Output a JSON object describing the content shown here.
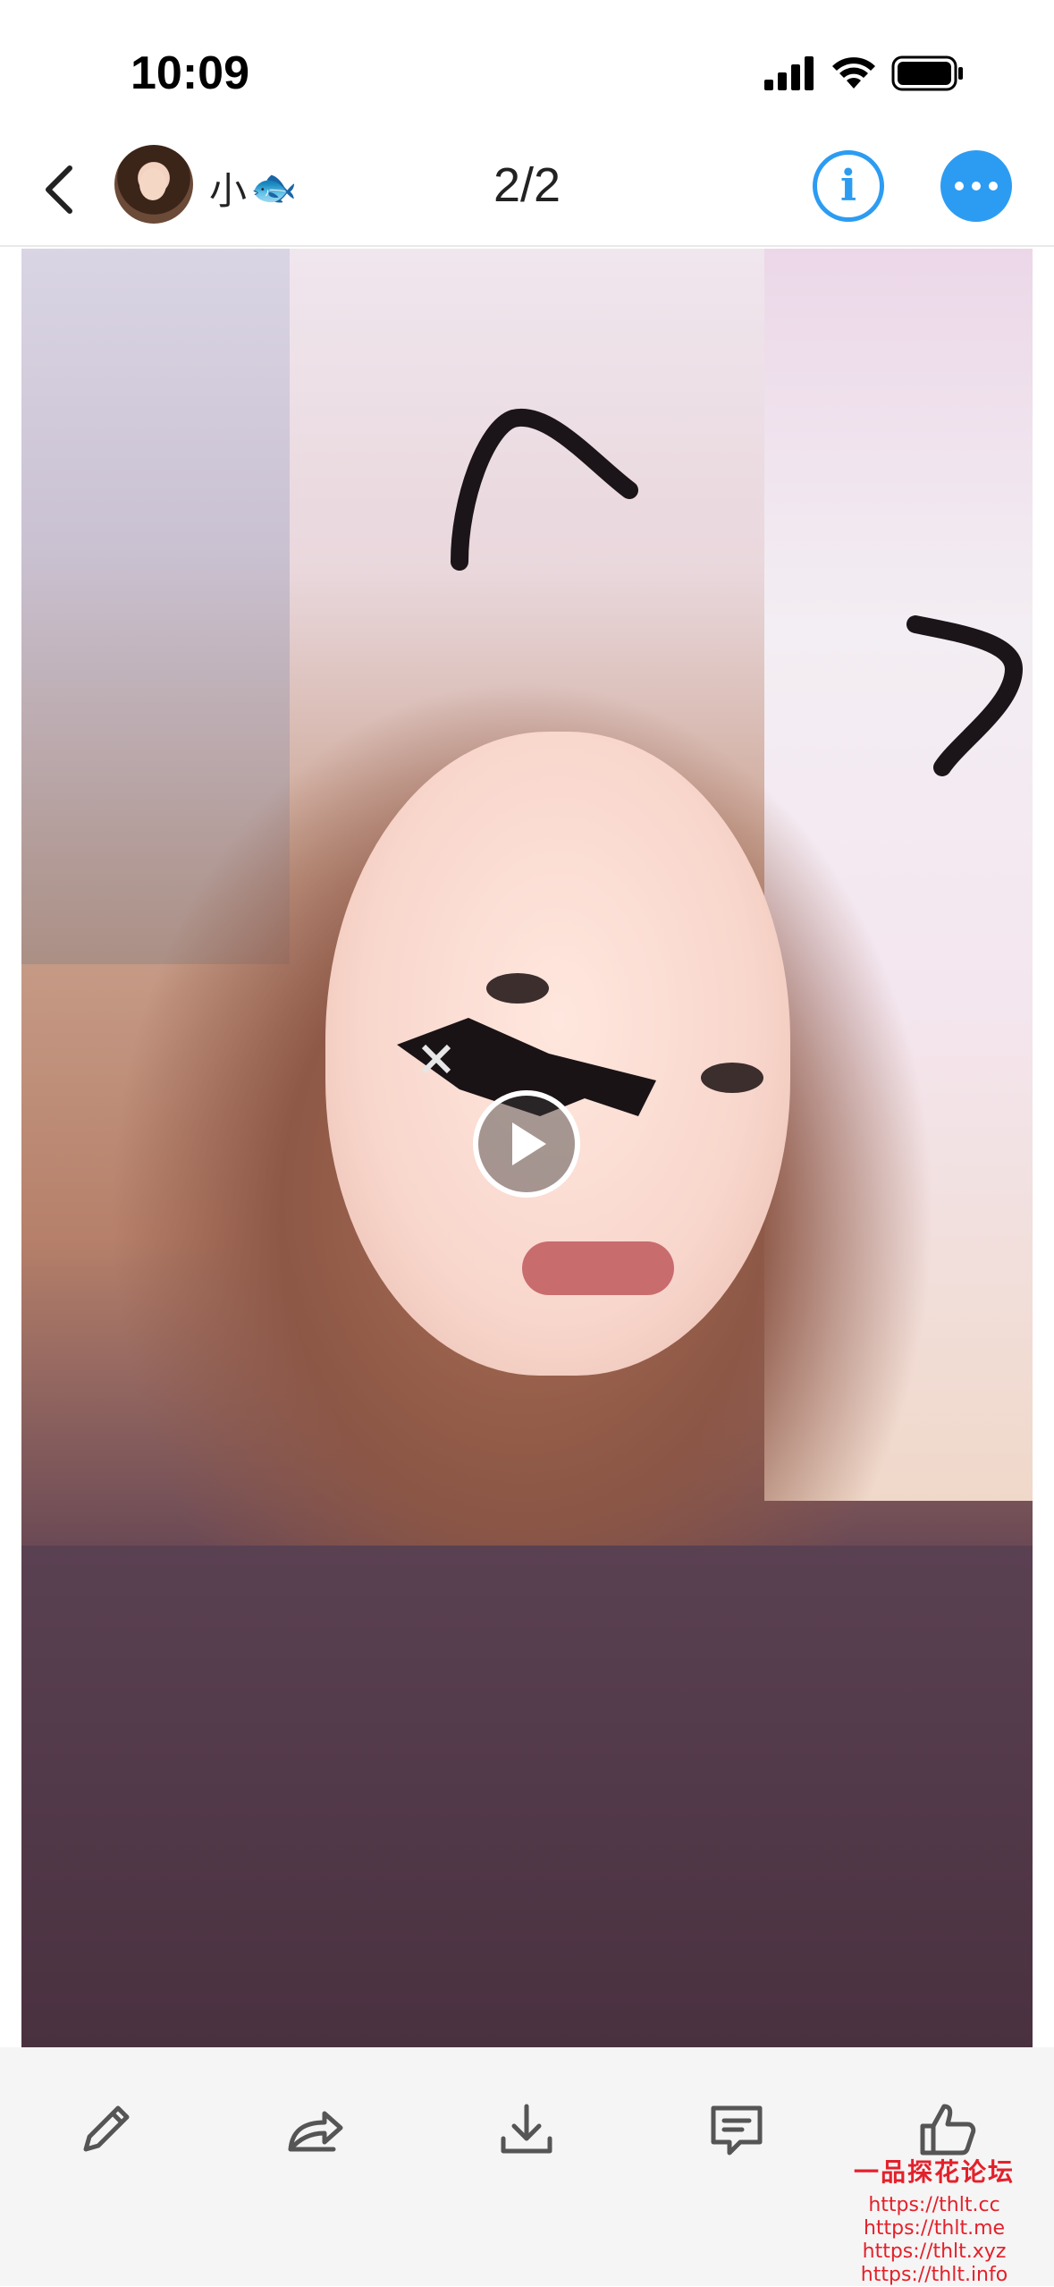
{
  "status_bar": {
    "time": "10:09",
    "signal_icon": "cellular-signal-icon",
    "wifi_icon": "wifi-icon",
    "battery_icon": "battery-icon"
  },
  "nav": {
    "back_icon": "chevron-left-icon",
    "username": "小",
    "username_emoji": "🐟",
    "page_counter": "2/2",
    "info_label": "i",
    "more_icon": "ellipsis-icon",
    "accent_color": "#2c9cf2"
  },
  "media": {
    "play_icon": "play-icon"
  },
  "toolbar": {
    "items": [
      {
        "icon": "pencil-icon"
      },
      {
        "icon": "share-icon"
      },
      {
        "icon": "download-icon"
      },
      {
        "icon": "comment-icon"
      },
      {
        "icon": "thumbs-up-icon"
      }
    ]
  },
  "watermark": {
    "title": "一品探花论坛",
    "lines": [
      "https://thlt.cc",
      "https://thlt.me",
      "https://thlt.xyz",
      "https://thlt.info"
    ],
    "color": "#e3212b"
  }
}
